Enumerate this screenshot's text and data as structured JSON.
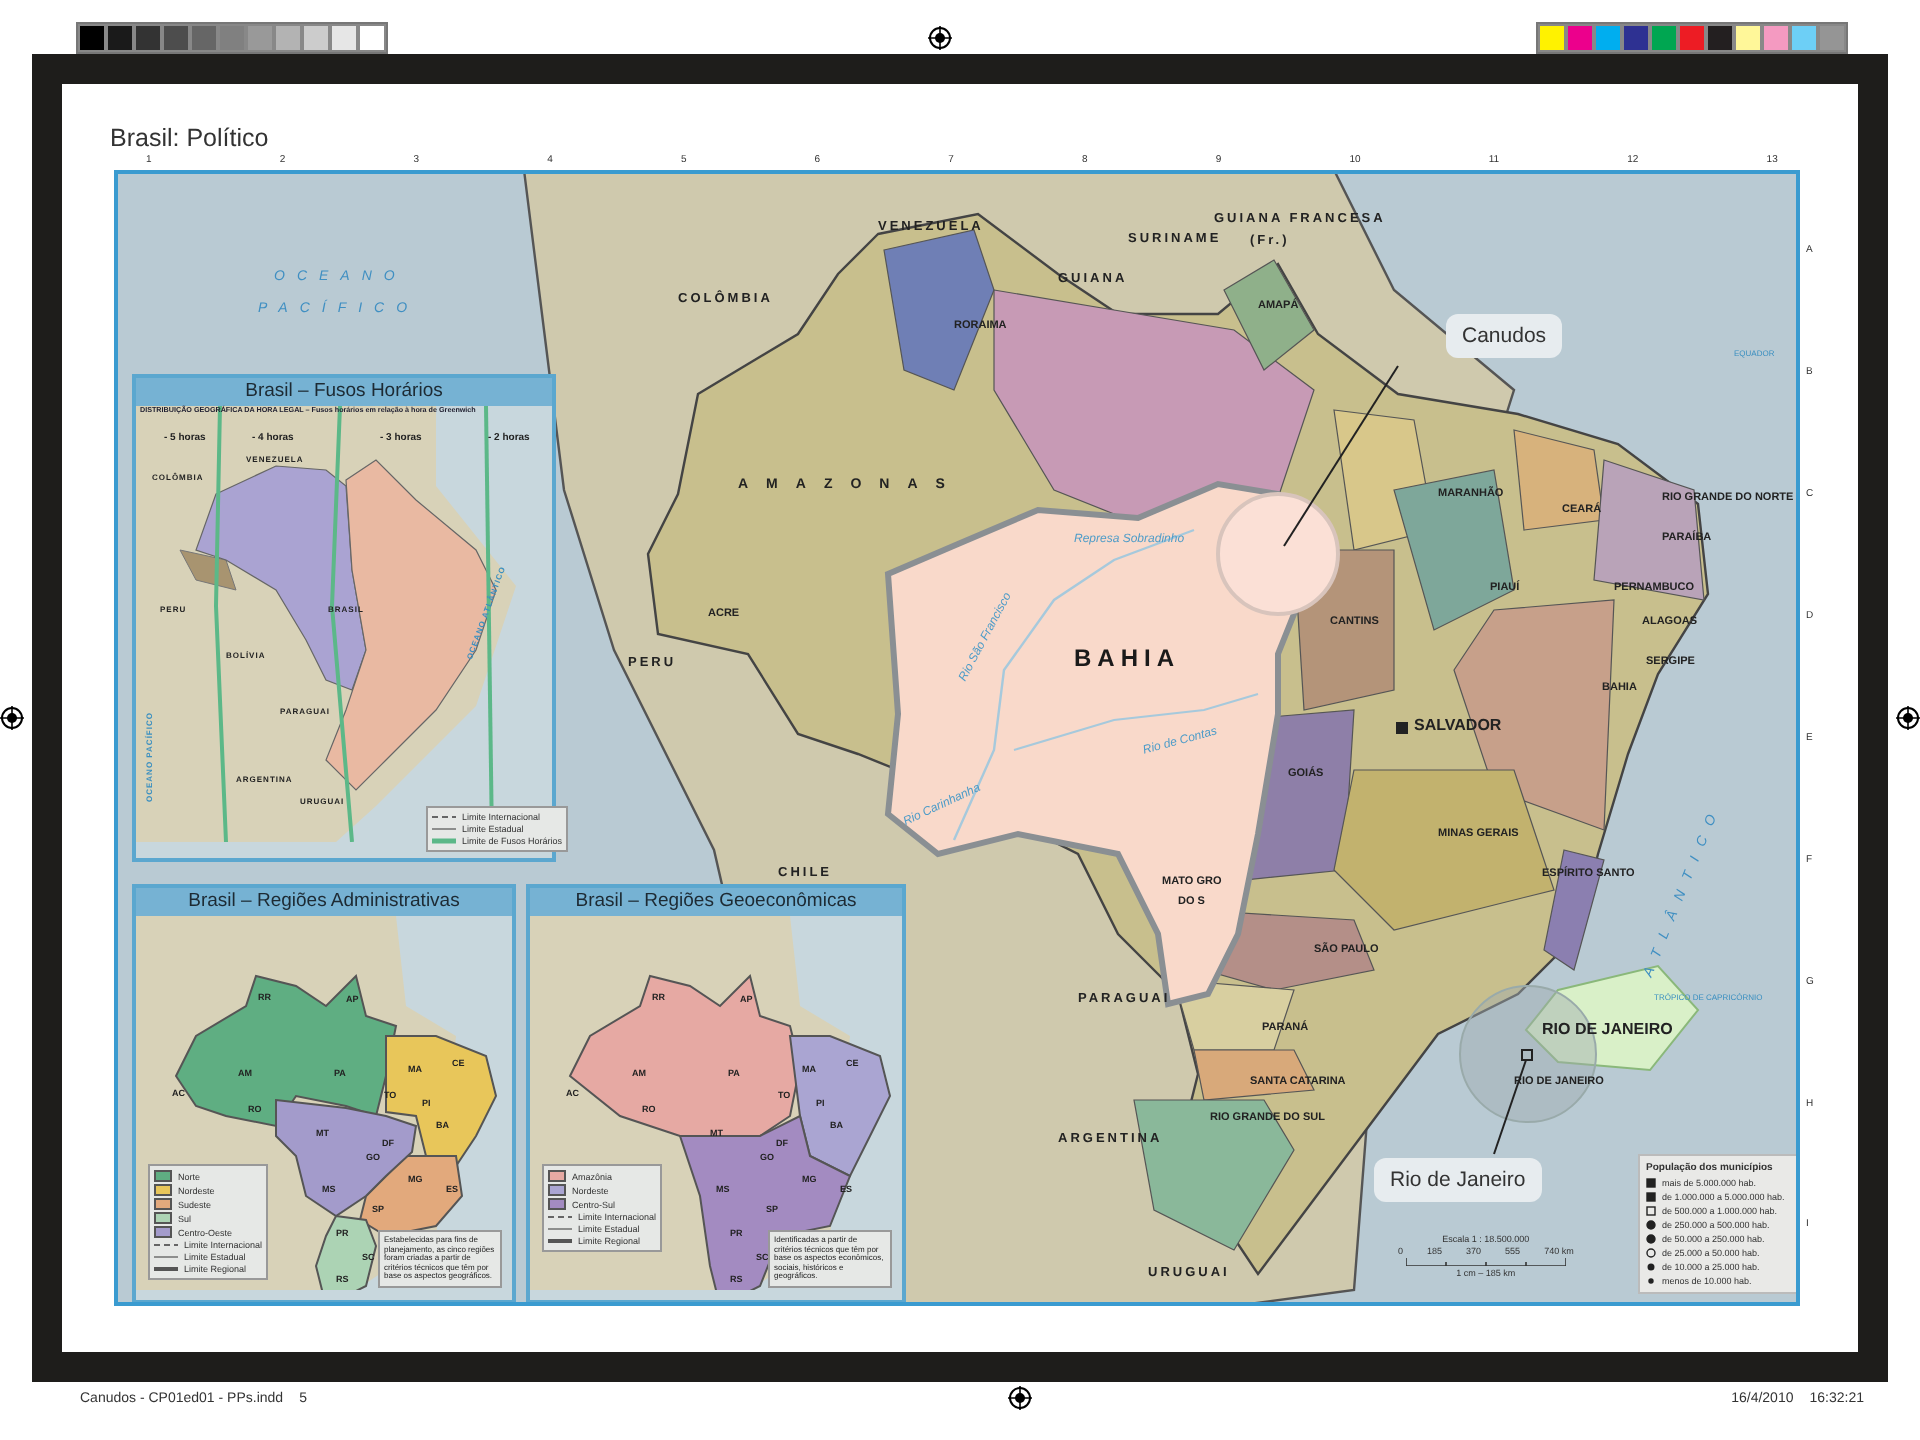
{
  "print_marks": {
    "gray_swatches": [
      {
        "color": "#000000"
      },
      {
        "color": "#1a1a1a"
      },
      {
        "color": "#333333"
      },
      {
        "color": "#4d4d4d"
      },
      {
        "color": "#666666"
      },
      {
        "color": "#808080"
      },
      {
        "color": "#999999"
      },
      {
        "color": "#b3b3b3"
      },
      {
        "color": "#cccccc"
      },
      {
        "color": "#e6e6e6"
      },
      {
        "color": "#ffffff"
      }
    ],
    "color_swatches": [
      {
        "color": "#fff200"
      },
      {
        "color": "#ec008c"
      },
      {
        "color": "#00aeef"
      },
      {
        "color": "#2e3192"
      },
      {
        "color": "#00a651"
      },
      {
        "color": "#ed1c24"
      },
      {
        "color": "#231f20"
      },
      {
        "color": "#fff799"
      },
      {
        "color": "#f49ac1"
      },
      {
        "color": "#6dcff6"
      },
      {
        "color": "#959595"
      }
    ]
  },
  "title": "Brasil: Político",
  "grid": {
    "columns": [
      "1",
      "2",
      "3",
      "4",
      "5",
      "6",
      "7",
      "8",
      "9",
      "10",
      "11",
      "12",
      "13"
    ],
    "rows": [
      "A",
      "B",
      "C",
      "D",
      "E",
      "F",
      "G",
      "H",
      "I"
    ]
  },
  "map": {
    "labels": [
      {
        "text": "VENEZUELA",
        "kind": "country"
      },
      {
        "text": "COLÔMBIA",
        "kind": "country"
      },
      {
        "text": "OCEANO",
        "kind": "ocean"
      },
      {
        "text": "PACÍFICO",
        "kind": "ocean"
      },
      {
        "text": "GUIANA",
        "kind": "country"
      },
      {
        "text": "SURINAME",
        "kind": "country"
      },
      {
        "text": "GUIANA FRANCESA",
        "kind": "country"
      },
      {
        "text": "(Fr.)",
        "kind": "country"
      },
      {
        "text": "RORAIMA",
        "kind": "state"
      },
      {
        "text": "AMAPÁ",
        "kind": "state"
      },
      {
        "text": "AMAZONAS",
        "kind": "state_wide"
      },
      {
        "text": "PERU",
        "kind": "country"
      },
      {
        "text": "ACRE",
        "kind": "state"
      },
      {
        "text": "BAHIA",
        "kind": "highlight"
      },
      {
        "text": "MARANHÃO",
        "kind": "state"
      },
      {
        "text": "CEARÁ",
        "kind": "state"
      },
      {
        "text": "RIO GRANDE DO NORTE",
        "kind": "state"
      },
      {
        "text": "PIAUÍ",
        "kind": "state"
      },
      {
        "text": "PARAÍBA",
        "kind": "state"
      },
      {
        "text": "PERNAMBUCO",
        "kind": "state"
      },
      {
        "text": "ALAGOAS",
        "kind": "state"
      },
      {
        "text": "SERGIPE",
        "kind": "state"
      },
      {
        "text": "CANTINS",
        "kind": "state"
      },
      {
        "text": "BAHIA",
        "kind": "state"
      },
      {
        "text": "SALVADOR",
        "kind": "capital"
      },
      {
        "text": "GOIÁS",
        "kind": "state"
      },
      {
        "text": "MINAS GERAIS",
        "kind": "state"
      },
      {
        "text": "ESPÍRITO SANTO",
        "kind": "state"
      },
      {
        "text": "MATO GRO",
        "kind": "state"
      },
      {
        "text": "DO S",
        "kind": "state"
      },
      {
        "text": "CHILE",
        "kind": "country"
      },
      {
        "text": "PARAGUAI",
        "kind": "country"
      },
      {
        "text": "SÃO PAULO",
        "kind": "state"
      },
      {
        "text": "PARANÁ",
        "kind": "state"
      },
      {
        "text": "SANTA CATARINA",
        "kind": "state"
      },
      {
        "text": "ARGENTINA",
        "kind": "country"
      },
      {
        "text": "RIO GRANDE DO SUL",
        "kind": "state"
      },
      {
        "text": "URUGUAI",
        "kind": "country"
      },
      {
        "text": "RIO DE JANEIRO",
        "kind": "region_big"
      },
      {
        "text": "RIO DE JANEIRO",
        "kind": "state"
      },
      {
        "text": "Rio São Francisco",
        "kind": "river"
      },
      {
        "text": "Represa Sobradinho",
        "kind": "river"
      },
      {
        "text": "Rio de Contas",
        "kind": "river"
      },
      {
        "text": "Rio Carinhanha",
        "kind": "river"
      },
      {
        "text": "ATLÂNTICO",
        "kind": "ocean"
      },
      {
        "text": "EQUADOR",
        "kind": "line"
      },
      {
        "text": "TRÓPICO DE CAPRICÓRNIO",
        "kind": "line"
      }
    ],
    "callouts": [
      {
        "text": "Canudos"
      },
      {
        "text": "Rio de Janeiro"
      }
    ],
    "population_legend": {
      "title": "População dos municípios",
      "items": [
        "mais de 5.000.000 hab.",
        "de 1.000.000 a 5.000.000 hab.",
        "de 500.000 a 1.000.000 hab.",
        "de 250.000 a 500.000 hab.",
        "de 50.000 a 250.000 hab.",
        "de 25.000 a 50.000 hab.",
        "de 10.000 a 25.000 hab.",
        "menos de 10.000 hab."
      ]
    },
    "scale": {
      "title": "Escala 1 : 18.500.000",
      "ticks": [
        "0",
        "185",
        "370",
        "555",
        "740 km"
      ],
      "note": "1 cm – 185 km"
    }
  },
  "time_zone_inset": {
    "title": "Brasil – Fusos Horários",
    "subtitle": "DISTRIBUIÇÃO GEOGRÁFICA DA HORA LEGAL – Fusos horários em relação à hora de Greenwich",
    "zones": [
      "- 5 horas",
      "- 4 horas",
      "- 3 horas",
      "- 2 horas"
    ],
    "labels": [
      "VENEZUELA",
      "COLÔMBIA",
      "PERU",
      "BOLÍVIA",
      "BRASIL",
      "PARAGUAI",
      "ARGENTINA",
      "URUGUAI",
      "OCEANO PACÍFICO",
      "OCEANO ATLÂNTICO"
    ],
    "legend": [
      {
        "text": "Limite Internacional",
        "kind": "international"
      },
      {
        "text": "Limite Estadual",
        "kind": "state"
      },
      {
        "text": "Limite de Fusos Horários",
        "kind": "zone"
      }
    ]
  },
  "region_insets": [
    {
      "kind": "administrative",
      "title": "Brasil – Regiões Administrativas",
      "regions": [
        {
          "name": "Norte",
          "color": "#5fae82"
        },
        {
          "name": "Nordeste",
          "color": "#e8c65a"
        },
        {
          "name": "Sudeste",
          "color": "#e2a97c"
        },
        {
          "name": "Sul",
          "color": "#acd3b4"
        },
        {
          "name": "Centro-Oeste",
          "color": "#a39bcb"
        }
      ],
      "lines": [
        {
          "text": "Limite Internacional",
          "kind": "international"
        },
        {
          "text": "Limite Estadual",
          "kind": "state"
        },
        {
          "text": "Limite Regional",
          "kind": "regional"
        }
      ],
      "states": [
        "RR",
        "AP",
        "AM",
        "PA",
        "AC",
        "RO",
        "TO",
        "MA",
        "CE",
        "PI",
        "BA",
        "MT",
        "GO",
        "DF",
        "MG",
        "MS",
        "SP",
        "ES",
        "PR",
        "SC",
        "RS"
      ],
      "note": "Estabelecidas para fins de planejamento, as cinco regiões foram criadas a partir de critérios técnicos que têm por base os aspectos geográficos."
    },
    {
      "kind": "geoeconomic",
      "title": "Brasil – Regiões Geoeconômicas",
      "regions": [
        {
          "name": "Amazônia",
          "color": "#e6a9a3"
        },
        {
          "name": "Nordeste",
          "color": "#aaa5d2"
        },
        {
          "name": "Centro-Sul",
          "color": "#a38bc1"
        }
      ],
      "lines": [
        {
          "text": "Limite Internacional",
          "kind": "international"
        },
        {
          "text": "Limite Estadual",
          "kind": "state"
        },
        {
          "text": "Limite Regional",
          "kind": "regional"
        }
      ],
      "states": [
        "RR",
        "AP",
        "AM",
        "PA",
        "AC",
        "RO",
        "TO",
        "MA",
        "CE",
        "PI",
        "BA",
        "MT",
        "GO",
        "DF",
        "MG",
        "MS",
        "SP",
        "ES",
        "PR",
        "SC",
        "RS"
      ],
      "note": "Identificadas a partir de critérios técnicos que têm por base os aspectos econômicos, sociais, históricos e geográficos."
    }
  ],
  "footer": {
    "file": "Canudos - CP01ed01 - PPs.indd",
    "page": "5",
    "date": "16/4/2010",
    "time": "16:32:21"
  }
}
